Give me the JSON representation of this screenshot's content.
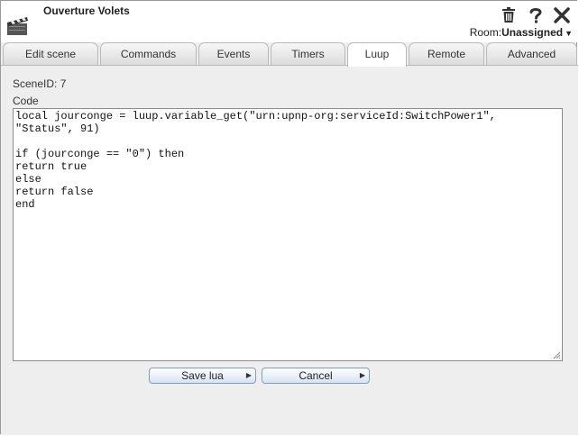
{
  "window": {
    "title": "Ouverture Volets"
  },
  "header": {
    "room_label": "Room:",
    "room_value": "Unassigned",
    "icons": [
      "trash-icon",
      "help-icon",
      "close-icon"
    ]
  },
  "tabs": [
    {
      "label": "Edit scene"
    },
    {
      "label": "Commands"
    },
    {
      "label": "Events"
    },
    {
      "label": "Timers"
    },
    {
      "label": "Luup",
      "active": true
    },
    {
      "label": "Remote"
    },
    {
      "label": "Advanced"
    }
  ],
  "luup": {
    "scene_id": "SceneID: 7",
    "code_label": "Code",
    "code": "local jourconge = luup.variable_get(\"urn:upnp-org:serviceId:SwitchPower1\",\n\"Status\", 91)\n\nif (jourconge == \"0\") then\nreturn true\nelse\nreturn false\nend"
  },
  "buttons": {
    "save": "Save lua",
    "cancel": "Cancel"
  },
  "colors": {
    "accent_border": "#7f9db9",
    "tab_border": "#b9b9b9",
    "background": "#eeeeee"
  }
}
